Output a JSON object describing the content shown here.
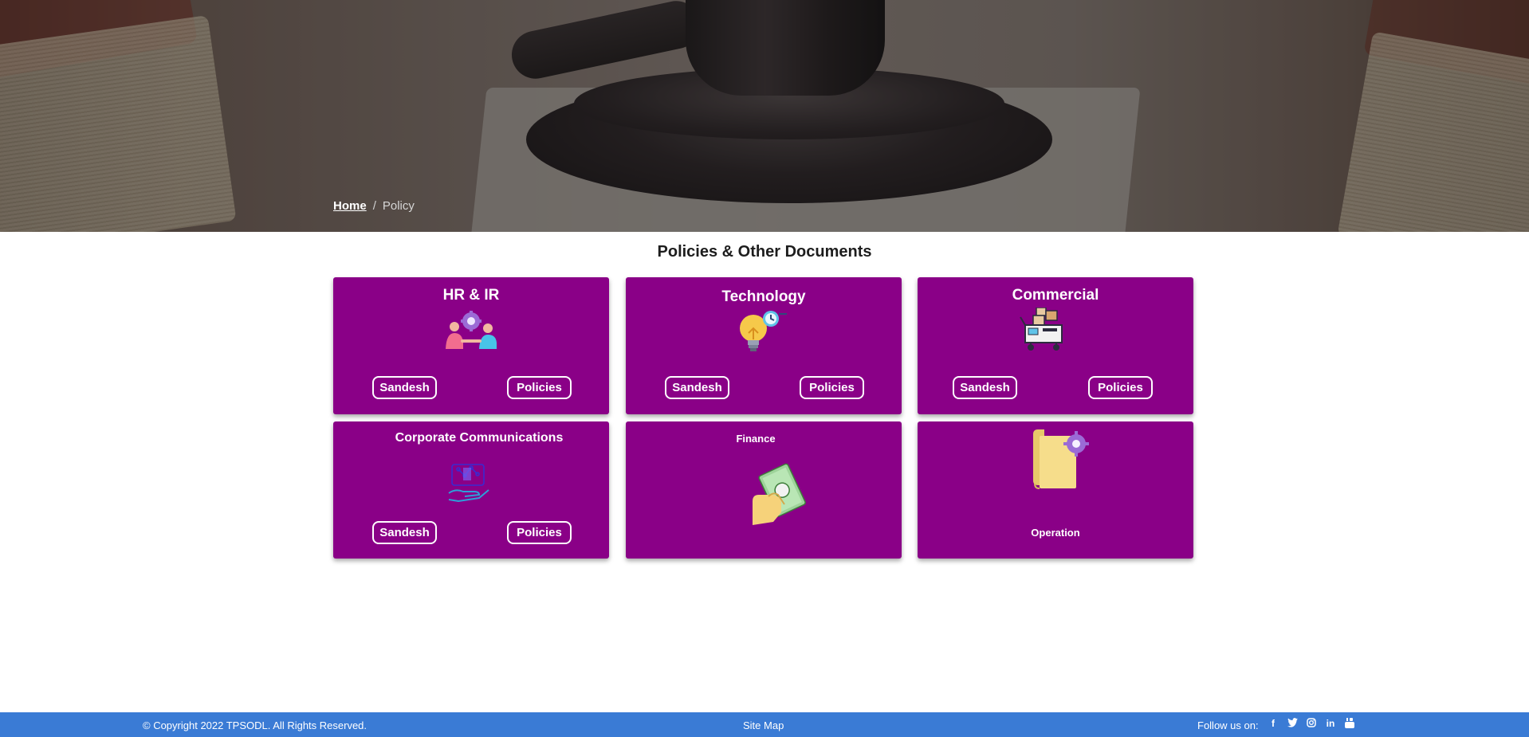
{
  "breadcrumb": {
    "home": "Home",
    "separator": "/",
    "current": "Policy"
  },
  "section_title": "Policies & Other Documents",
  "cards": [
    {
      "title": "HR & IR",
      "icon": "team-gear-icon",
      "buttons": [
        "Sandesh",
        "Policies"
      ]
    },
    {
      "title": "Technology",
      "icon": "lightbulb-clock-icon",
      "buttons": [
        "Sandesh",
        "Policies"
      ]
    },
    {
      "title": "Commercial",
      "icon": "cart-boxes-icon",
      "buttons": [
        "Sandesh",
        "Policies"
      ]
    },
    {
      "title": "Corporate Communications",
      "icon": "hand-network-icon",
      "buttons": [
        "Sandesh",
        "Policies"
      ]
    },
    {
      "title": "Finance",
      "icon": "hand-cash-icon"
    },
    {
      "title": "Operation",
      "icon": "scroll-gear-icon"
    }
  ],
  "footer": {
    "copyright": "© Copyright 2022 TPSODL. All Rights Reserved.",
    "site_map": "Site Map",
    "follow_label": "Follow us on:",
    "social": [
      "f",
      "t",
      "ig",
      "in",
      "yt"
    ]
  },
  "colors": {
    "card_bg": "#8a0087",
    "footer_bg": "#3a7bd5"
  }
}
